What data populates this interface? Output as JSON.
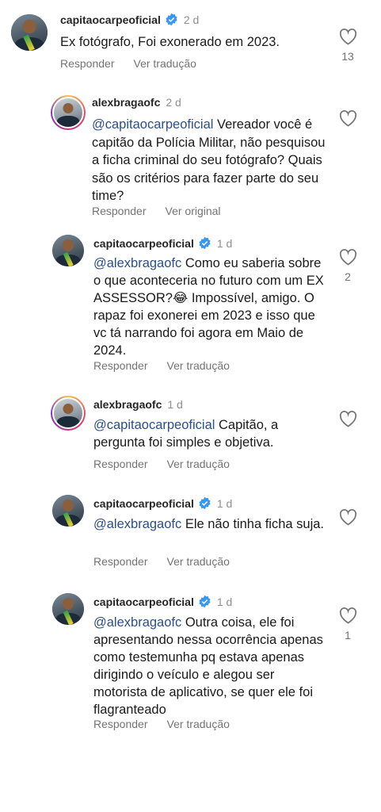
{
  "actions": {
    "reply": "Responder",
    "see_translation": "Ver tradução",
    "see_original": "Ver original"
  },
  "comments": [
    {
      "username": "capitaocarpeoficial",
      "verified": true,
      "time": "2 d",
      "text": "Ex fotógrafo, Foi exonerado em 2023.",
      "mention": "",
      "likes": "13"
    },
    {
      "username": "alexbragaofc",
      "verified": false,
      "time": "2 d",
      "mention": "@capitaocarpeoficial",
      "text": " Vereador você é capitão da Polícia Militar, não pesquisou a ficha criminal do seu fotógrafo? Quais são os critérios para fazer parte do seu time?",
      "likes": ""
    },
    {
      "username": "capitaocarpeoficial",
      "verified": true,
      "time": "1 d",
      "mention": "@alexbragaofc",
      "text": " Como eu saberia sobre o que aconteceria no futuro com um EX ASSESSOR?😂 Impossível, amigo. O rapaz foi exonerei em 2023 e isso que vc tá narrando foi agora em Maio de 2024.",
      "likes": "2"
    },
    {
      "username": "alexbragaofc",
      "verified": false,
      "time": "1 d",
      "mention": "@capitaocarpeoficial",
      "text": " Capitão, a pergunta foi simples e objetiva.",
      "likes": ""
    },
    {
      "username": "capitaocarpeoficial",
      "verified": true,
      "time": "1 d",
      "mention": "@alexbragaofc",
      "text": " Ele não tinha ficha suja.",
      "likes": ""
    },
    {
      "username": "capitaocarpeoficial",
      "verified": true,
      "time": "1 d",
      "mention": "@alexbragaofc",
      "text": " Outra coisa, ele foi apresentando nessa ocorrência apenas como testemunha pq estava apenas dirigindo o veículo e alegou ser motorista de aplicativo, se quer ele foi flagranteado",
      "likes": "1"
    }
  ],
  "colors": {
    "verified": "#3897f0",
    "mention": "#2b4f8a",
    "muted": "#737373"
  }
}
